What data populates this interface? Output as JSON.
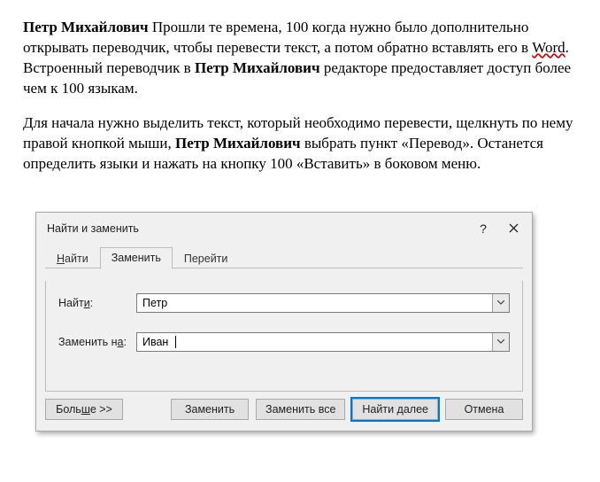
{
  "document": {
    "p1": {
      "bold_lead": "Петр Михайлович",
      "seg1": " Прошли те времена, 100 когда нужно было дополнительно открывать переводчик, чтобы перевести текст, а потом обратно вставлять его в ",
      "word_link": "Word",
      "seg2": ". Встроенный переводчик в ",
      "bold_end": "Петр Михайлович",
      "seg3": " редакторе предоставляет доступ более чем к 100 языкам."
    },
    "p2": {
      "seg1": "Для начала нужно выделить текст, который необходимо перевести, щелкнуть по нему правой кнопкой мыши, ",
      "bold": "Петр Михайлович",
      "seg2": " выбрать пункт «Перевод». Останется определить языки и нажать на кнопку 100 «Вставить» в боковом меню."
    }
  },
  "dialog": {
    "title": "Найти и заменить",
    "help": "?",
    "tabs": [
      {
        "u_char": "Н",
        "rest": "айти"
      },
      {
        "u_char": "",
        "rest": "Заменить"
      },
      {
        "u_char": "",
        "rest": "Перейти"
      }
    ],
    "find": {
      "label_u": "и",
      "label_pre": "Найт",
      "label_post": ":",
      "value": "Петр"
    },
    "replace": {
      "label_pre": "Заменить н",
      "label_u": "а",
      "label_post": ":",
      "value": "Иван"
    },
    "buttons": {
      "more_pre": "Боль",
      "more_u": "ш",
      "more_post": "е >>",
      "replace": "Заменить",
      "replace_all": "Заменить все",
      "find_next": "Найти далее",
      "cancel": "Отмена"
    }
  }
}
